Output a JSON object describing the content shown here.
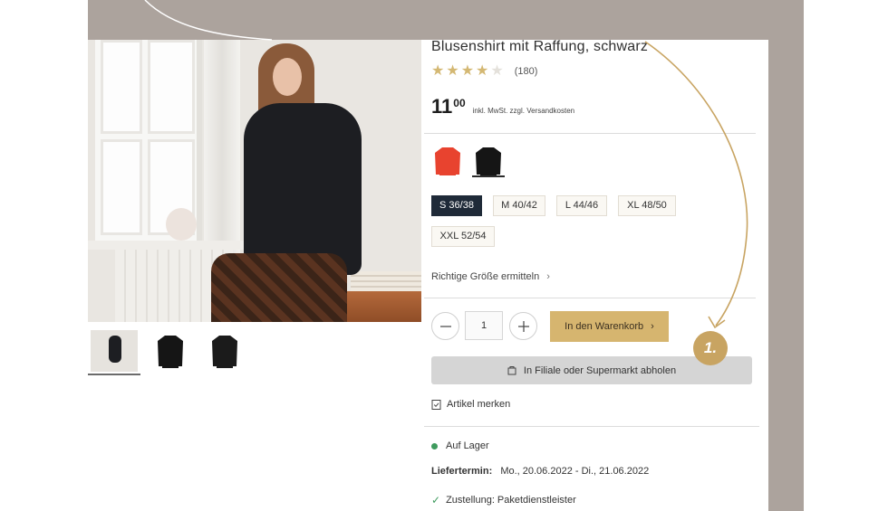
{
  "product": {
    "title": "Blusenshirt mit Raffung, schwarz",
    "rating": {
      "value": 4,
      "max": 5,
      "review_count": "(180)"
    },
    "price": {
      "integer": "11",
      "decimals": "00",
      "note": "inkl. MwSt. zzgl. Versandkosten"
    }
  },
  "gallery": {
    "main_image": "woman-in-black-blouse-photo",
    "thumbnails": [
      {
        "name": "model-photo-thumb"
      },
      {
        "name": "blouse-front-thumb"
      },
      {
        "name": "blouse-back-thumb"
      }
    ]
  },
  "colors": [
    {
      "name": "rot",
      "hex": "#e8432f",
      "selected": false
    },
    {
      "name": "schwarz",
      "hex": "#151515",
      "selected": true
    }
  ],
  "sizes": [
    {
      "label": "S 36/38",
      "selected": true
    },
    {
      "label": "M 40/42",
      "selected": false
    },
    {
      "label": "L 44/46",
      "selected": false
    },
    {
      "label": "XL 48/50",
      "selected": false
    },
    {
      "label": "XXL 52/54",
      "selected": false
    }
  ],
  "size_help": "Richtige Größe ermitteln",
  "quantity": "1",
  "cart_button": "In den Warenkorb",
  "pickup_button": "In Filiale oder Supermarkt abholen",
  "wishlist": "Artikel merken",
  "availability": {
    "stock": "Auf Lager",
    "delivery_label": "Liefertermin:",
    "delivery_value": "Mo., 20.06.2022 - Di., 21.06.2022",
    "shipping": "Zustellung: Paketdienstleister"
  },
  "annotation": {
    "label": "1."
  },
  "colors_theme": {
    "accent_gold": "#d6b56f",
    "selected_size": "#1f2a38",
    "stock_green": "#3f9b5e",
    "background_taupe": "#aca39d"
  }
}
